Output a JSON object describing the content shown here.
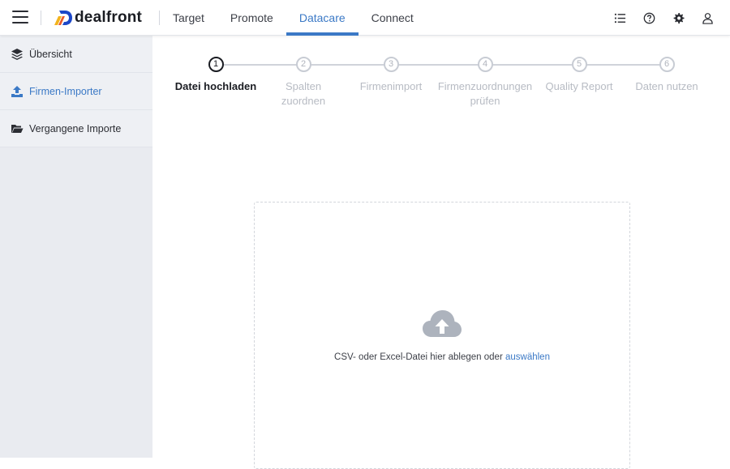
{
  "header": {
    "logo_text": "dealfront",
    "tabs": [
      {
        "label": "Target"
      },
      {
        "label": "Promote"
      },
      {
        "label": "Datacare"
      },
      {
        "label": "Connect"
      }
    ],
    "active_tab": "Datacare",
    "icons": [
      "list-icon",
      "help-icon",
      "settings-icon",
      "user-icon"
    ]
  },
  "sidebar": {
    "items": [
      {
        "label": "Übersicht",
        "icon": "layers-icon"
      },
      {
        "label": "Firmen-Importer",
        "icon": "upload-icon",
        "active": true
      },
      {
        "label": "Vergangene Importe",
        "icon": "folder-open-icon"
      }
    ]
  },
  "stepper": {
    "steps": [
      {
        "number": "1",
        "label": "Datei hochladen",
        "active": true
      },
      {
        "number": "2",
        "label": "Spalten zuordnen"
      },
      {
        "number": "3",
        "label": "Firmenimport"
      },
      {
        "number": "4",
        "label": "Firmenzuordnungen prüfen"
      },
      {
        "number": "5",
        "label": "Quality Report"
      },
      {
        "number": "6",
        "label": "Daten nutzen"
      }
    ]
  },
  "dropzone": {
    "text": "CSV- oder Excel-Datei hier ablegen oder",
    "link": "auswählen",
    "icon": "cloud-upload-icon"
  },
  "colors": {
    "accent": "#3b79c6",
    "sidebar_bg": "#e9ebf0",
    "inactive_step": "#b7bbc3"
  }
}
